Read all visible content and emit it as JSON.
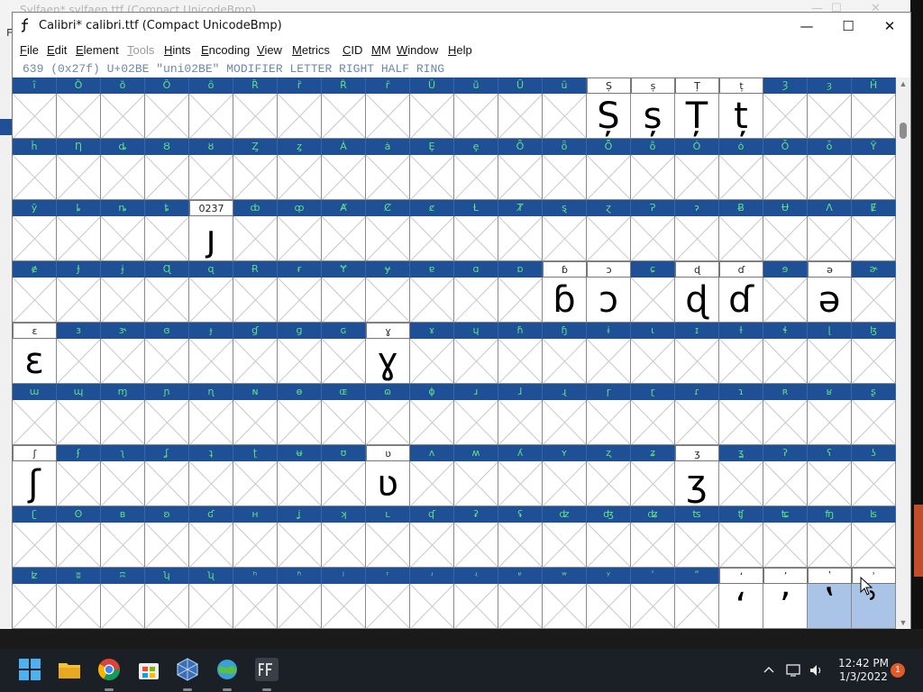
{
  "background_window": {
    "title": "Sylfaen*  sylfaen.ttf (Compact UnicodeBmp)",
    "menu_fragment": "F",
    "controls": [
      "—",
      "☐",
      "✕"
    ]
  },
  "window": {
    "title": "Calibri*  calibri.ttf (Compact UnicodeBmp)",
    "controls": {
      "minimize": "—",
      "maximize": "☐",
      "close": "✕"
    }
  },
  "menu": [
    {
      "label": "File",
      "ul": "F",
      "rest": "ile",
      "disabled": false
    },
    {
      "label": "Edit",
      "ul": "E",
      "rest": "dit",
      "disabled": false
    },
    {
      "label": "Element",
      "ul": "E",
      "rest": "lement",
      "disabled": false
    },
    {
      "label": "Tools",
      "ul": "T",
      "rest": "ools",
      "disabled": true
    },
    {
      "label": "Hints",
      "ul": "H",
      "rest": "ints",
      "disabled": false
    },
    {
      "label": "Encoding",
      "ul": "E",
      "rest": "ncoding",
      "disabled": false
    },
    {
      "label": "View",
      "ul": "V",
      "rest": "iew",
      "disabled": false
    },
    {
      "label": "Metrics",
      "ul": "M",
      "rest": "etrics",
      "disabled": false
    },
    {
      "label": "CID",
      "ul": "C",
      "rest": "ID",
      "disabled": false
    },
    {
      "label": "MM",
      "ul": "M",
      "rest": "M",
      "disabled": false
    },
    {
      "label": "Window",
      "ul": "W",
      "rest": "indow",
      "disabled": false
    },
    {
      "label": "Help",
      "ul": "H",
      "rest": "elp",
      "disabled": false
    }
  ],
  "info": "639 (0x27f) U+02BE \"uni02BE\" MODIFIER LETTER RIGHT HALF RING",
  "grid": {
    "rows": [
      {
        "labels": [
          "ȋ",
          "Ȍ",
          "ȍ",
          "Ȏ",
          "ȏ",
          "Ȑ",
          "ȑ",
          "Ȓ",
          "ȓ",
          "Ȕ",
          "ȕ",
          "Ȗ",
          "ȗ",
          "Ș",
          "ș",
          "Ț",
          "ț",
          "Ȝ",
          "ȝ",
          "Ȟ"
        ],
        "glyphs": {
          "13": "Ș",
          "14": "ș",
          "15": "Ț",
          "16": "ț"
        }
      },
      {
        "labels": [
          "ȟ",
          "Ƞ",
          "ȡ",
          "Ȣ",
          "ȣ",
          "Ȥ",
          "ȥ",
          "Ȧ",
          "ȧ",
          "Ȩ",
          "ȩ",
          "Ȫ",
          "ȫ",
          "Ȭ",
          "ȭ",
          "Ȯ",
          "ȯ",
          "Ȱ",
          "ȱ",
          "Ȳ"
        ],
        "glyphs": {}
      },
      {
        "labels": [
          "ȳ",
          "ȴ",
          "ȵ",
          "ȶ",
          "0237",
          "ȸ",
          "ȹ",
          "Ⱥ",
          "Ȼ",
          "ȼ",
          "Ƚ",
          "Ⱦ",
          "ȿ",
          "ɀ",
          "Ɂ",
          "ɂ",
          "Ƀ",
          "Ʉ",
          "Ʌ",
          "Ɇ"
        ],
        "glyphs": {
          "4": "ȷ"
        }
      },
      {
        "labels": [
          "ɇ",
          "Ɉ",
          "ɉ",
          "Ɋ",
          "ɋ",
          "Ɍ",
          "ɍ",
          "Ɏ",
          "ɏ",
          "ɐ",
          "ɑ",
          "ɒ",
          "ɓ",
          "ɔ",
          "ɕ",
          "ɖ",
          "ɗ",
          "ɘ",
          "ə",
          "ɚ"
        ],
        "glyphs": {
          "12": "ɓ",
          "13": "ɔ",
          "15": "ɖ",
          "16": "ɗ",
          "18": "ə"
        }
      },
      {
        "labels": [
          "ɛ",
          "ɜ",
          "ɝ",
          "ɞ",
          "ɟ",
          "ɠ",
          "ɡ",
          "ɢ",
          "ɣ",
          "ɤ",
          "ɥ",
          "ɦ",
          "ɧ",
          "ɨ",
          "ɩ",
          "ɪ",
          "ɫ",
          "ɬ",
          "ɭ",
          "ɮ"
        ],
        "glyphs": {
          "0": "ɛ",
          "8": "ɣ"
        }
      },
      {
        "labels": [
          "ɯ",
          "ɰ",
          "ɱ",
          "ɲ",
          "ɳ",
          "ɴ",
          "ɵ",
          "ɶ",
          "ɷ",
          "ɸ",
          "ɹ",
          "ɺ",
          "ɻ",
          "ɼ",
          "ɽ",
          "ɾ",
          "ɿ",
          "ʀ",
          "ʁ",
          "ʂ"
        ],
        "glyphs": {}
      },
      {
        "labels": [
          "ʃ",
          "ʄ",
          "ʅ",
          "ʆ",
          "ʇ",
          "ʈ",
          "ʉ",
          "ʊ",
          "ʋ",
          "ʌ",
          "ʍ",
          "ʎ",
          "ʏ",
          "ʐ",
          "ʑ",
          "ʒ",
          "ʓ",
          "ʔ",
          "ʕ",
          "ʖ"
        ],
        "glyphs": {
          "0": "ʃ",
          "8": "ʋ",
          "15": "ʒ"
        }
      },
      {
        "labels": [
          "ʗ",
          "ʘ",
          "ʙ",
          "ʚ",
          "ʛ",
          "ʜ",
          "ʝ",
          "ʞ",
          "ʟ",
          "ʠ",
          "ʡ",
          "ʢ",
          "ʣ",
          "ʤ",
          "ʥ",
          "ʦ",
          "ʧ",
          "ʨ",
          "ʩ",
          "ʪ"
        ],
        "glyphs": {}
      },
      {
        "labels": [
          "ʫ",
          "ʬ",
          "ʭ",
          "ʮ",
          "ʯ",
          "ʰ",
          "ʱ",
          "ʲ",
          "ʳ",
          "ʴ",
          "ʵ",
          "ʶ",
          "ʷ",
          "ʸ",
          "ʹ",
          "ʺ",
          "ʻ",
          "ʼ",
          "ʽ",
          "ʾ"
        ],
        "glyphs": {
          "16": "ʻ",
          "17": "ʼ",
          "18": "ʽ",
          "19": "ʾ"
        }
      }
    ],
    "selected": {
      "row": 8,
      "cols": [
        18,
        19
      ]
    }
  },
  "taskbar": {
    "icons": [
      "windows-start-icon",
      "file-explorer-icon",
      "chrome-icon",
      "microsoft-store-icon",
      "virtualbox-icon",
      "network-globe-icon",
      "fontforge-icon"
    ],
    "clock_time": "12:42 PM",
    "clock_date": "1/3/2022",
    "notification_count": "1"
  },
  "colors": {
    "label_bg": "#1f4f94",
    "label_fg": "#5fe08a",
    "selection": "#a9c4e6",
    "info_text": "#6b87b2"
  }
}
